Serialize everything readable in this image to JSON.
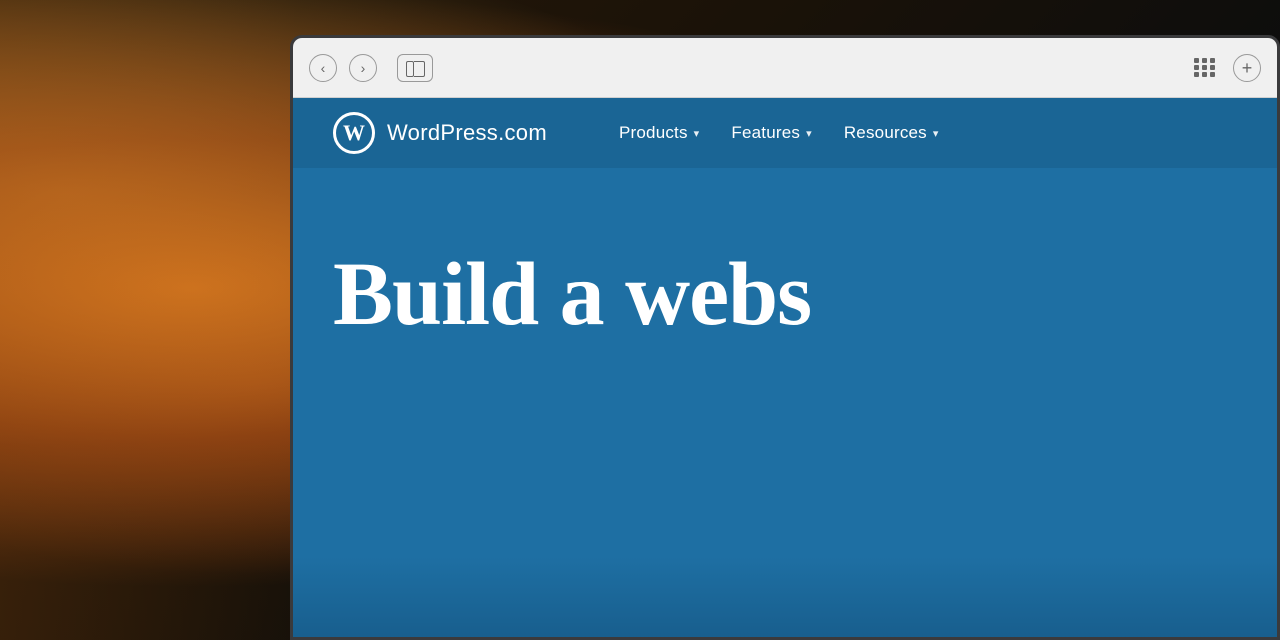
{
  "background": {
    "description": "Warm bokeh background photo effect"
  },
  "browser": {
    "back_button": "‹",
    "forward_button": "›",
    "add_tab_button": "+",
    "grid_dots": 9
  },
  "website": {
    "logo": {
      "symbol": "W",
      "name": "WordPress.com"
    },
    "nav": {
      "items": [
        {
          "label": "Products",
          "has_dropdown": true
        },
        {
          "label": "Features",
          "has_dropdown": true
        },
        {
          "label": "Resources",
          "has_dropdown": true
        }
      ]
    },
    "hero": {
      "title": "Build a webs"
    }
  }
}
